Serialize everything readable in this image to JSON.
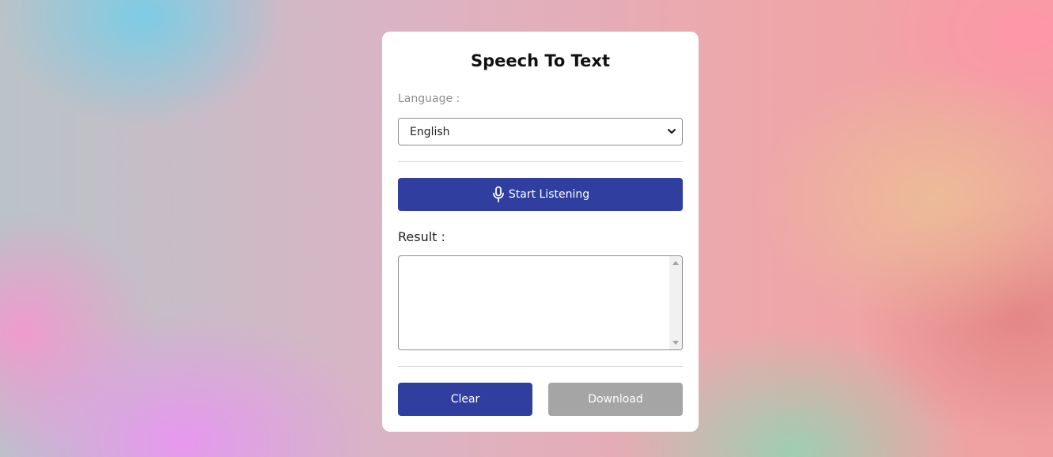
{
  "app": {
    "title": "Speech To Text"
  },
  "language": {
    "label": "Language :",
    "selected": "English"
  },
  "listen_button": {
    "label": "Start Listening",
    "icon": "microphone-icon"
  },
  "result": {
    "label": "Result :",
    "value": ""
  },
  "actions": {
    "clear_label": "Clear",
    "download_label": "Download"
  },
  "colors": {
    "primary": "#303f9f",
    "disabled": "#a5a5a5"
  }
}
